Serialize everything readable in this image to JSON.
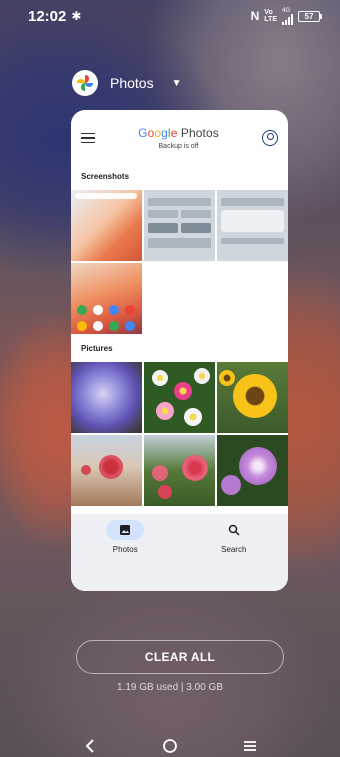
{
  "status": {
    "time": "12:02",
    "volte": [
      "Vo",
      "LTE"
    ],
    "network": "4G",
    "battery": "57"
  },
  "recents": {
    "app_name": "Photos",
    "clear_all_label": "CLEAR ALL",
    "memory": "1.19 GB used | 3.00 GB"
  },
  "photos_app": {
    "logo_text": "Google Photos",
    "subtitle": "Backup is off",
    "sections": [
      {
        "label": "Screenshots"
      },
      {
        "label": "Pictures"
      }
    ],
    "tabs": [
      {
        "label": "Photos",
        "active": true
      },
      {
        "label": "Search",
        "active": false
      }
    ]
  },
  "icons": {
    "gear": "gear-icon",
    "hamburger": "menu-icon",
    "account": "account-icon",
    "photos_tab": "image-icon",
    "search_tab": "search-icon",
    "back": "back-icon",
    "home": "home-icon",
    "recents": "recents-icon"
  },
  "colors": {
    "google_blue": "#4285F4",
    "google_red": "#EA4335",
    "google_yellow": "#FBBC05",
    "google_green": "#34A853",
    "active_tab_pill": "#d3e3fd"
  }
}
